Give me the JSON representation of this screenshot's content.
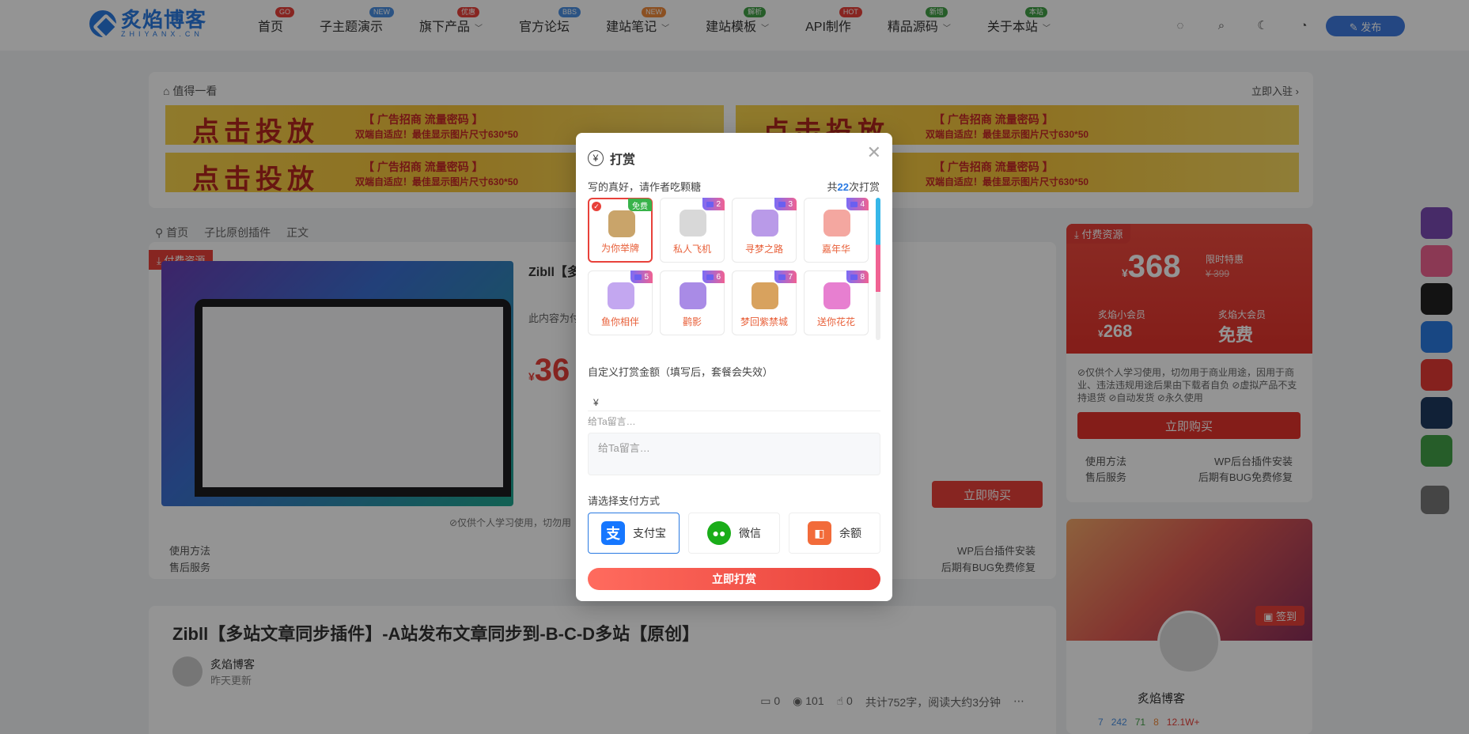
{
  "header": {
    "logo_cn": "炙焰博客",
    "logo_en": "ZHIYANX.CN",
    "nav": [
      {
        "label": "首页",
        "badge": "GO",
        "badge_color": "#e8413a",
        "has_dropdown": false
      },
      {
        "label": "子主题演示",
        "badge": "NEW",
        "badge_color": "#4a90e2",
        "has_dropdown": false
      },
      {
        "label": "旗下产品",
        "badge": "优惠",
        "badge_color": "#e8413a",
        "has_dropdown": true
      },
      {
        "label": "官方论坛",
        "badge": "BBS",
        "badge_color": "#4a90e2",
        "has_dropdown": false
      },
      {
        "label": "建站笔记",
        "badge": "NEW",
        "badge_color": "#f08a3c",
        "has_dropdown": true
      },
      {
        "label": "建站模板",
        "badge": "解析",
        "badge_color": "#43a047",
        "has_dropdown": true
      },
      {
        "label": "API制作",
        "badge": "HOT",
        "badge_color": "#e8413a",
        "has_dropdown": false
      },
      {
        "label": "精品源码",
        "badge": "新增",
        "badge_color": "#43a047",
        "has_dropdown": true
      },
      {
        "label": "关于本站",
        "badge": "本站",
        "badge_color": "#43a047",
        "has_dropdown": true
      }
    ],
    "publish_label": "✎ 发布"
  },
  "ads": {
    "heading": "值得一看",
    "join": "立即入驻",
    "banner_big": "点击投放",
    "banner_small": "【 广告招商 流量密码 】",
    "banner_small2": "双端自适应！最佳显示图片尺寸630*50"
  },
  "breadcrumb": [
    "首页",
    "子比原创插件",
    "正文"
  ],
  "product": {
    "paid_tag": "付费资源",
    "title_partial": "Zibll【多",
    "desc_partial": "此内容为付",
    "price_partial": "36",
    "buy": "立即购买",
    "notes": "⊘仅供个人学习使用，切勿用",
    "usage_label": "使用方法",
    "usage_value": "WP后台插件安装",
    "service_label": "售后服务",
    "service_value": "后期有BUG免费修复"
  },
  "article": {
    "title": "Zibll【多站文章同步插件】-A站发布文章同步到-B-C-D多站【原创】",
    "author": "炙焰博客",
    "time": "昨天更新",
    "comments": "0",
    "views": "101",
    "likes": "0",
    "words": "共计752字，阅读大约3分钟"
  },
  "sidebar": {
    "paid_tag": "付费资源",
    "price": "368",
    "limited": "限时特惠",
    "old_price": "399",
    "member1_label": "炙焰小会员",
    "member1_price": "268",
    "member2_label": "炙焰大会员",
    "member2_price": "免费",
    "notes": "⊘仅供个人学习使用，切勿用于商业用途，因用于商业、违法违规用途后果由下载者自负 ⊘虚拟产品不支持退货 ⊘自动发货 ⊘永久使用",
    "buy": "立即购买",
    "usage_label": "使用方法",
    "usage_value": "WP后台插件安装",
    "service_label": "售后服务",
    "service_value": "后期有BUG免费修复",
    "signin": "签到",
    "profile_name": "炙焰博客",
    "stats": [
      "7",
      "242",
      "71",
      "8",
      "12.1W+"
    ]
  },
  "modal": {
    "title": "打赏",
    "subtitle": "写的真好，请作者吃颗糖",
    "count_prefix": "共",
    "count": "22",
    "count_suffix": "次打赏",
    "gifts": [
      {
        "label": "为你举牌",
        "badge": "免费",
        "color": "#c9a46a"
      },
      {
        "label": "私人飞机",
        "badge": "2",
        "color": "#d8d8d8"
      },
      {
        "label": "寻梦之路",
        "badge": "3",
        "color": "#b99ae8"
      },
      {
        "label": "嘉年华",
        "badge": "4",
        "color": "#f4a7a0"
      },
      {
        "label": "鱼你相伴",
        "badge": "5",
        "color": "#c3a7f0"
      },
      {
        "label": "鹳影",
        "badge": "6",
        "color": "#a98be6"
      },
      {
        "label": "梦回紫禁城",
        "badge": "7",
        "color": "#d8a25e"
      },
      {
        "label": "送你花花",
        "badge": "8",
        "color": "#e77fd0"
      }
    ],
    "custom_label": "自定义打赏金额（填写后，套餐会失效）",
    "currency": "¥",
    "amount_value": "",
    "message_label": "给Ta留言…",
    "message_placeholder": "给Ta留言…",
    "pay_label": "请选择支付方式",
    "pay_methods": [
      {
        "label": "支付宝",
        "icon": "alipay-icon"
      },
      {
        "label": "微信",
        "icon": "wechat-icon"
      },
      {
        "label": "余额",
        "icon": "wallet-icon"
      }
    ],
    "submit": "立即打赏"
  },
  "colors": {
    "accent": "#e8413a",
    "brand": "#2a7ae2",
    "overlay": "rgba(0,0,0,0.42)"
  }
}
